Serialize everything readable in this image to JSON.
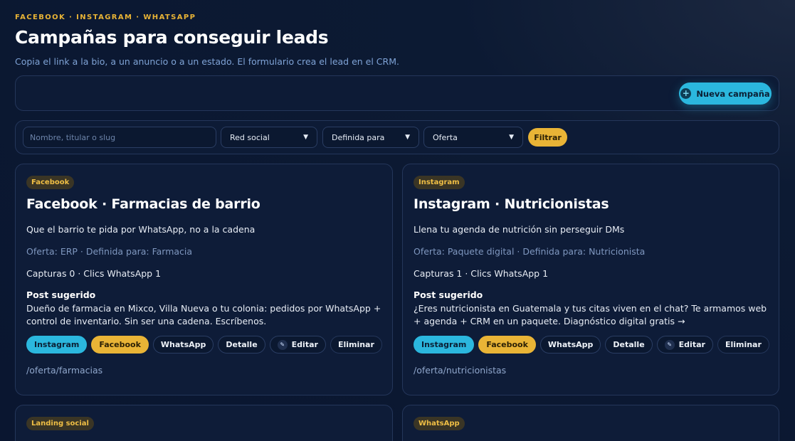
{
  "header": {
    "eyebrow": "FACEBOOK · INSTAGRAM · WHATSAPP",
    "title": "Campañas para conseguir leads",
    "subtitle": "Copia el link a la bio, a un anuncio o a un estado. El formulario crea el lead en el CRM."
  },
  "actions": {
    "new_campaign_label": "Nueva campaña"
  },
  "filters": {
    "search_placeholder": "Nombre, titular o slug",
    "network_value": "Red social",
    "audience_value": "Definida para",
    "offer_value": "Oferta",
    "filter_label": "Filtrar"
  },
  "buttons": {
    "instagram": "Instagram",
    "facebook": "Facebook",
    "whatsapp": "WhatsApp",
    "detail": "Detalle",
    "edit": "Editar",
    "delete": "Eliminar"
  },
  "cards": [
    {
      "badge": "Facebook",
      "title": "Facebook · Farmacias de barrio",
      "description": "Que el barrio te pida por WhatsApp, no a la cadena",
      "meta": "Oferta: ERP · Definida para: Farmacia",
      "stats": "Capturas 0 · Clics WhatsApp 1",
      "post_heading": "Post sugerido",
      "post_body": "Dueño de farmacia en Mixco, Villa Nueva o tu colonia: pedidos por WhatsApp + control de inventario. Sin ser una cadena. Escríbenos.",
      "link": "/oferta/farmacias"
    },
    {
      "badge": "Instagram",
      "title": "Instagram · Nutricionistas",
      "description": "Llena tu agenda de nutrición sin perseguir DMs",
      "meta": "Oferta: Paquete digital · Definida para: Nutricionista",
      "stats": "Capturas 1 · Clics WhatsApp 1",
      "post_heading": "Post sugerido",
      "post_body": "¿Eres nutricionista en Guatemala y tus citas viven en el chat? Te armamos web + agenda + CRM en un paquete. Diagnóstico digital gratis →",
      "link": "/oferta/nutricionistas"
    },
    {
      "badge": "Landing social"
    },
    {
      "badge": "WhatsApp"
    }
  ],
  "colors": {
    "accent_cyan": "#2bb7de",
    "accent_gold": "#e9b436",
    "background": "#0b1730"
  }
}
